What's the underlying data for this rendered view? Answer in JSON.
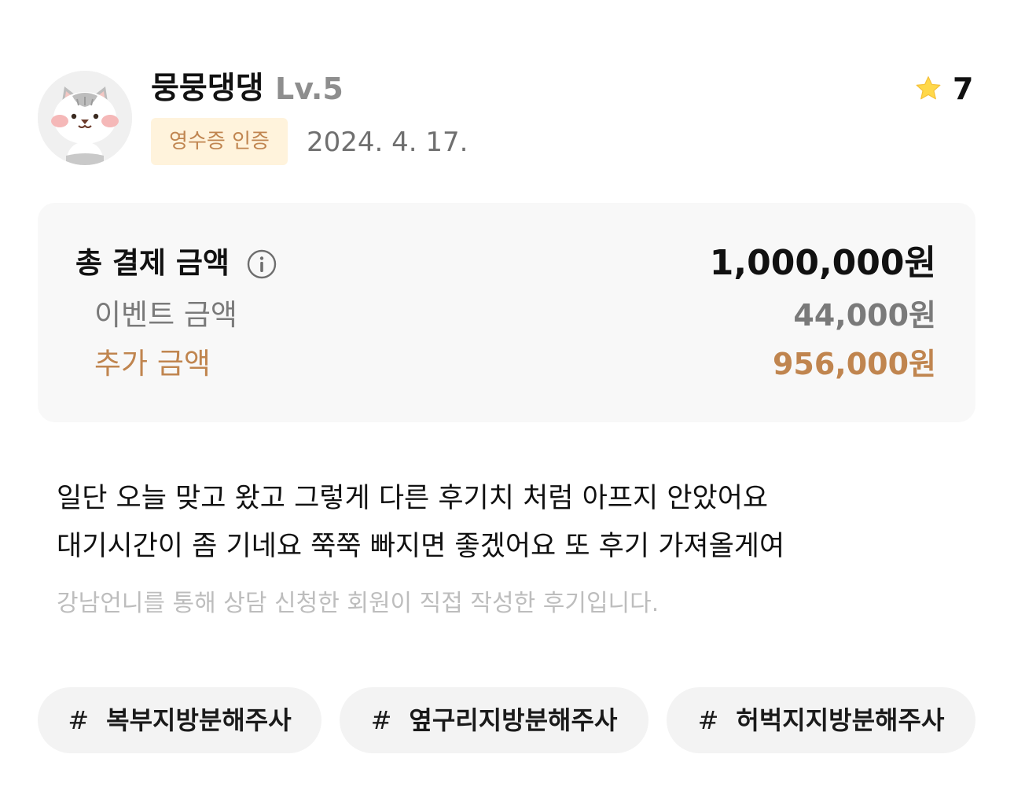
{
  "reviewer": {
    "nickname": "뭉뭉댕댕",
    "level": "Lv.5",
    "badge": "영수증 인증",
    "date": "2024. 4. 17.",
    "rating": "7",
    "icons": {
      "avatar": "cat-avatar-icon",
      "rating": "star-icon"
    }
  },
  "price": {
    "total_label": "총 결제 금액",
    "total_value": "1,000,000원",
    "event_label": "이벤트 금액",
    "event_value": "44,000원",
    "extra_label": "추가 금액",
    "extra_value": "956,000원",
    "info_icon": "info-icon"
  },
  "review": {
    "line1": "일단 오늘 맞고 왔고 그렇게 다른 후기치 처럼 아프지 안았어요",
    "line2": "대기시간이 좀 기네요 쭉쭉 빠지면 좋겠어요 또 후기 가져올게여",
    "disclaimer": "강남언니를 통해 상담 신청한 회원이 직접 작성한 후기입니다."
  },
  "tags": [
    {
      "hash": "#",
      "label": "복부지방분해주사"
    },
    {
      "hash": "#",
      "label": "옆구리지방분해주사"
    },
    {
      "hash": "#",
      "label": "허벅지지방분해주사"
    }
  ],
  "colors": {
    "badge_bg": "#fff3dc",
    "accent": "#c0854f",
    "muted": "#7a7a7a",
    "star": "#ffd84a",
    "card_bg": "#f8f8f8",
    "tag_bg": "#f3f3f3"
  }
}
